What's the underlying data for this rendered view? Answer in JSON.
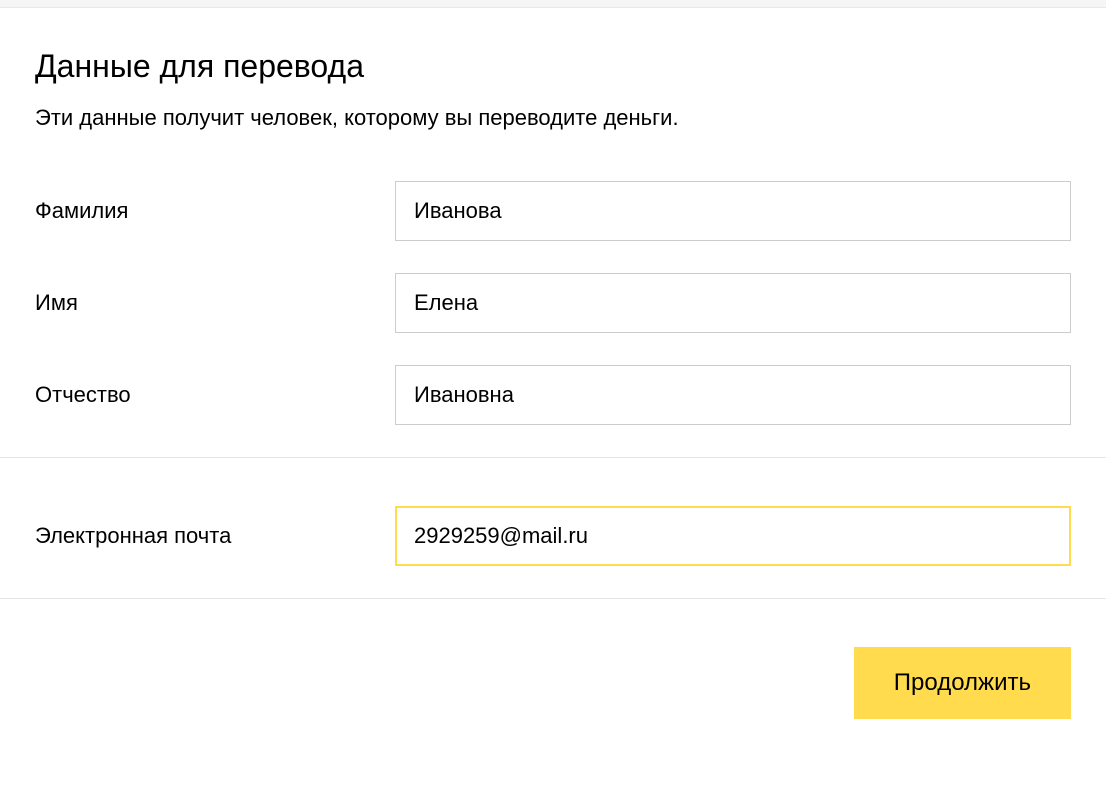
{
  "heading": "Данные для перевода",
  "subtitle": "Эти данные получит человек, которому вы переводите деньги.",
  "form": {
    "lastName": {
      "label": "Фамилия",
      "value": "Иванова"
    },
    "firstName": {
      "label": "Имя",
      "value": "Елена"
    },
    "middleName": {
      "label": "Отчество",
      "value": "Ивановна"
    },
    "email": {
      "label": "Электронная почта",
      "value": "2929259@mail.ru"
    }
  },
  "continueButton": "Продолжить"
}
